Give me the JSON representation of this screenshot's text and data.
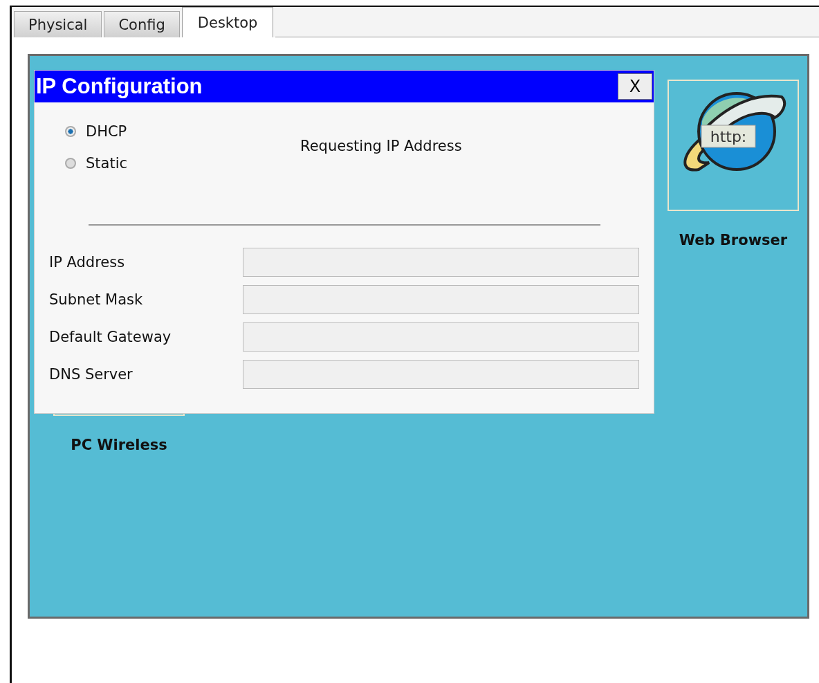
{
  "tabs": [
    {
      "label": "Physical",
      "selected": false
    },
    {
      "label": "Config",
      "selected": false
    },
    {
      "label": "Desktop",
      "selected": true
    }
  ],
  "desktop": {
    "apps": [
      {
        "label": "Web Browser",
        "kind": "browser",
        "icon_text": "http:"
      },
      {
        "label": "PC Wireless",
        "kind": "hidden"
      }
    ]
  },
  "dialog": {
    "title": "IP Configuration",
    "close": "X",
    "modes": [
      {
        "label": "DHCP",
        "selected": true
      },
      {
        "label": "Static",
        "selected": false
      }
    ],
    "status": "Requesting IP Address",
    "fields": [
      {
        "label": "IP Address"
      },
      {
        "label": "Subnet Mask"
      },
      {
        "label": "Default Gateway"
      },
      {
        "label": "DNS Server"
      }
    ]
  }
}
